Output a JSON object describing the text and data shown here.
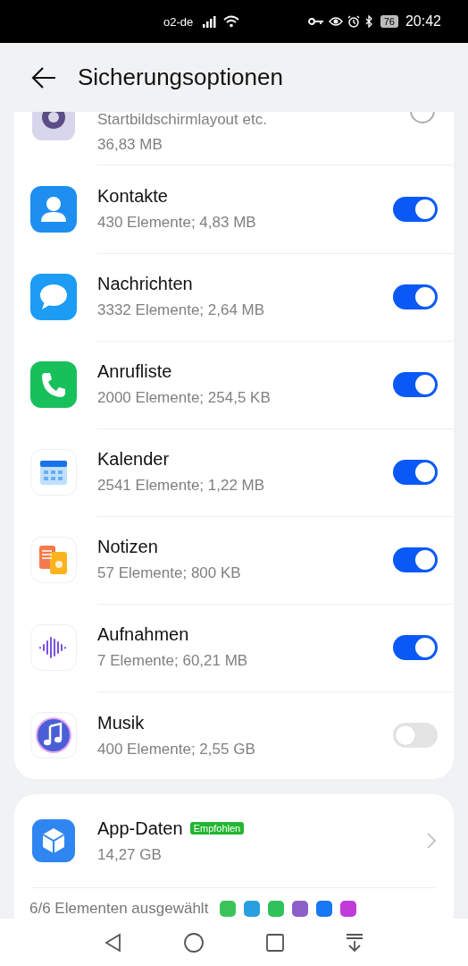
{
  "status_bar": {
    "carrier": "o2-de",
    "battery": "76",
    "time": "20:42"
  },
  "header": {
    "title": "Sicherungsoptionen"
  },
  "items": [
    {
      "kind": "partial",
      "subtitle": "Startbildschirmlayout etc.",
      "size": "36,83 MB"
    },
    {
      "kind": "toggle",
      "title": "Kontakte",
      "subtitle": "430 Elemente; 4,83 MB",
      "checked": true
    },
    {
      "kind": "toggle",
      "title": "Nachrichten",
      "subtitle": "3332 Elemente; 2,64 MB",
      "checked": true
    },
    {
      "kind": "toggle",
      "title": "Anrufliste",
      "subtitle": "2000 Elemente; 254,5 KB",
      "checked": true
    },
    {
      "kind": "toggle",
      "title": "Kalender",
      "subtitle": "2541 Elemente; 1,22 MB",
      "checked": true
    },
    {
      "kind": "toggle",
      "title": "Notizen",
      "subtitle": "57 Elemente; 800 KB",
      "checked": true
    },
    {
      "kind": "toggle",
      "title": "Aufnahmen",
      "subtitle": "7 Elemente; 60,21 MB",
      "checked": true
    },
    {
      "kind": "toggle",
      "title": "Musik",
      "subtitle": "400 Elemente; 2,55 GB",
      "checked": false
    }
  ],
  "app_data": {
    "title": "App-Daten",
    "badge": "Empfohlen",
    "size": "14,27 GB",
    "summary": "6/6 Elementen ausgewählt"
  }
}
